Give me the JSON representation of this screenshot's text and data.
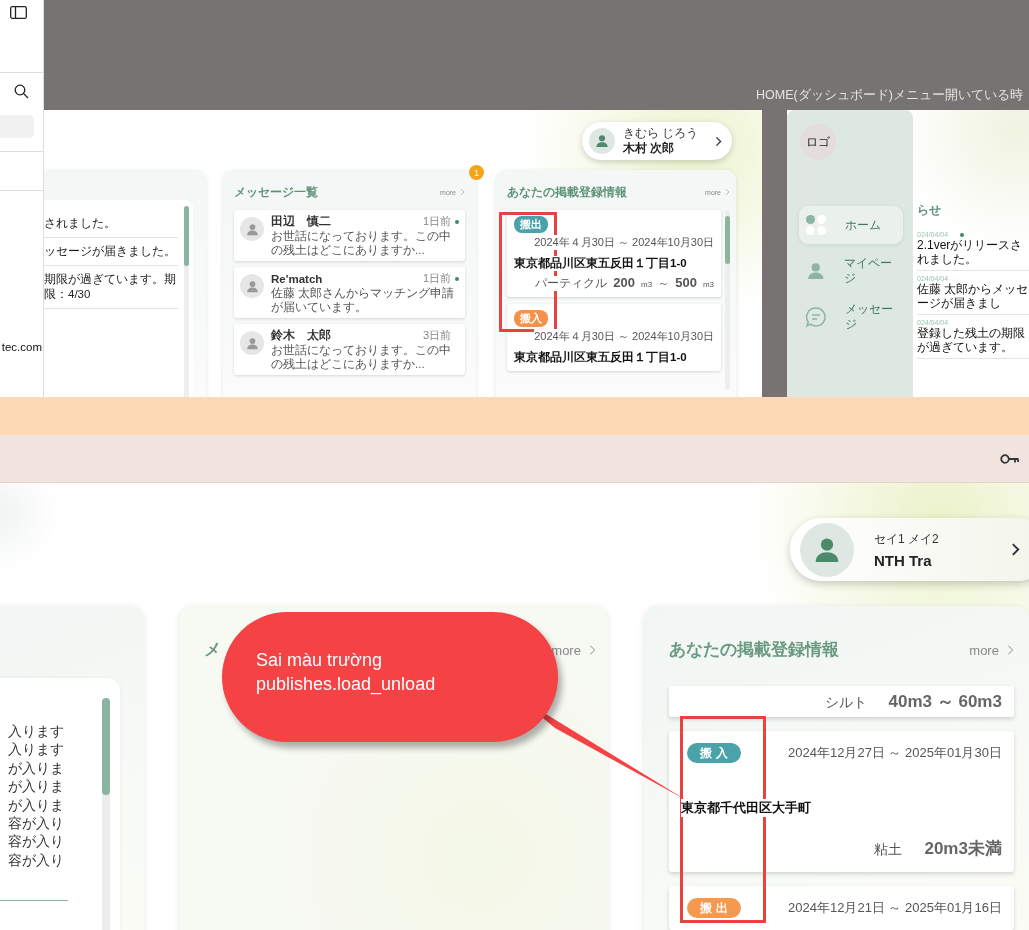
{
  "tool_sidebar": {
    "fragment_text": "tec.com"
  },
  "caption": "HOME(ダッシュボード)メニュー開いている時",
  "mockup_dashboard": {
    "user": {
      "kana": "きむら じろう",
      "name": "木村 次郎"
    },
    "notices": [
      {
        "text": "されました。"
      },
      {
        "text": "ッセージが届きました。"
      },
      {
        "text": "期限が過ぎています。期限：4/30"
      }
    ],
    "messages": {
      "title": "メッセージ一覧",
      "more": "more",
      "badge": "1",
      "items": [
        {
          "name": "田辺　慎二",
          "time": "1日前",
          "preview": "お世話になっております。この中の残土はどこにありますか...",
          "unread": true
        },
        {
          "name": "Re'match",
          "time": "1日前",
          "preview": "佐藤 太郎さんからマッチング申請が届いています。",
          "unread": true
        },
        {
          "name": "鈴木　太郎",
          "time": "3日前",
          "preview": "お世話になっております。この中の残土はどこにありますか...",
          "unread": false
        }
      ]
    },
    "listings": {
      "title": "あなたの掲載登録情報",
      "more": "more",
      "items": [
        {
          "type": "搬出",
          "color": "#4aa3a8",
          "period": "2024年４月30日 ～ 2024年10月30日",
          "address": "東京都品川区東五反田１丁目1-0",
          "soil": "パーティクル",
          "amounts": [
            {
              "value": "200",
              "unit": "m3"
            },
            {
              "value": "500",
              "unit": "m3"
            }
          ],
          "range_mark": "～"
        },
        {
          "type": "搬入",
          "color": "#f4924a",
          "period": "2024年４月30日 ～ 2024年10月30日",
          "address": "東京都品川区東五反田１丁目1-0"
        }
      ]
    }
  },
  "mockup_menu": {
    "logo": "ロゴ",
    "menu": [
      {
        "kind": "home",
        "label": "ホーム",
        "selected": true
      },
      {
        "kind": "person",
        "label": "マイページ",
        "selected": false
      },
      {
        "kind": "chat",
        "label": "メッセージ",
        "selected": false
      }
    ],
    "news": {
      "title": "らせ",
      "items": [
        {
          "date": "024/04/04",
          "text": "2.1verがリリースされました。",
          "unread": true
        },
        {
          "date": "024/04/04",
          "text": "佐藤 太郎からメッセージが届きまし",
          "unread": false
        },
        {
          "date": "024/04/04",
          "text": "登録した残土の期限が過ぎています。",
          "unread": false
        }
      ]
    }
  },
  "app": {
    "user": {
      "kana": "セイ1 メイ2",
      "name": "NTH Tra"
    },
    "notice_lines": [
      "入ります",
      "入ります",
      "が入りま",
      "が入りま",
      "が入りま",
      "容が入り",
      "容が入り",
      "容が入り"
    ],
    "messages": {
      "title": "メ",
      "more": "more"
    },
    "listings": {
      "title": "あなたの掲載登録情報",
      "more": "more",
      "items": [
        {
          "soil": "シルト",
          "amount": "40m3 ～ 60m3"
        },
        {
          "type": "搬入",
          "color": "#4aa3a8",
          "period": "2024年12月27日 ～ 2025年01月30日",
          "address": "東京都千代田区大手町",
          "soil": "粘土",
          "amount": "20m3未満"
        },
        {
          "type": "搬出",
          "color": "#f5994e",
          "period": "2024年12月21日 ～ 2025年01月16日"
        }
      ]
    }
  },
  "annotation": {
    "text": "Sai màu trường\npublishes.load_unload"
  }
}
